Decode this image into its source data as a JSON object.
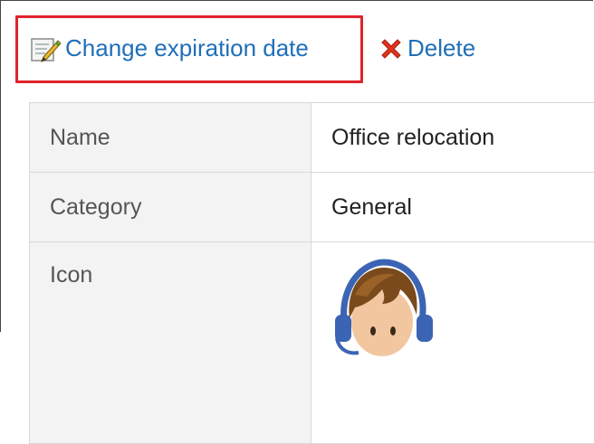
{
  "toolbar": {
    "change_label": "Change expiration date",
    "delete_label": "Delete",
    "change_icon": "edit-note-icon",
    "delete_icon": "red-x-icon",
    "highlight_color": "#e0242c",
    "link_color": "#1f6fb8"
  },
  "details": {
    "rows": [
      {
        "label": "Name",
        "value": "Office relocation"
      },
      {
        "label": "Category",
        "value": "General"
      },
      {
        "label": "Icon",
        "value_icon": "avatar-headset-icon"
      }
    ]
  }
}
